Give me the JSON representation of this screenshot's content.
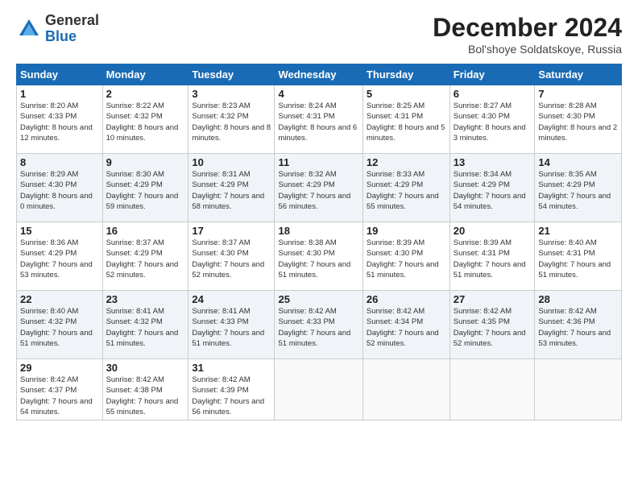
{
  "header": {
    "logo": {
      "general": "General",
      "blue": "Blue"
    },
    "title": "December 2024",
    "location": "Bol'shoye Soldatskoye, Russia"
  },
  "calendar": {
    "weekdays": [
      "Sunday",
      "Monday",
      "Tuesday",
      "Wednesday",
      "Thursday",
      "Friday",
      "Saturday"
    ],
    "weeks": [
      [
        {
          "day": 1,
          "sunrise": "8:20 AM",
          "sunset": "4:33 PM",
          "daylight": "8 hours and 12 minutes."
        },
        {
          "day": 2,
          "sunrise": "8:22 AM",
          "sunset": "4:32 PM",
          "daylight": "8 hours and 10 minutes."
        },
        {
          "day": 3,
          "sunrise": "8:23 AM",
          "sunset": "4:32 PM",
          "daylight": "8 hours and 8 minutes."
        },
        {
          "day": 4,
          "sunrise": "8:24 AM",
          "sunset": "4:31 PM",
          "daylight": "8 hours and 6 minutes."
        },
        {
          "day": 5,
          "sunrise": "8:25 AM",
          "sunset": "4:31 PM",
          "daylight": "8 hours and 5 minutes."
        },
        {
          "day": 6,
          "sunrise": "8:27 AM",
          "sunset": "4:30 PM",
          "daylight": "8 hours and 3 minutes."
        },
        {
          "day": 7,
          "sunrise": "8:28 AM",
          "sunset": "4:30 PM",
          "daylight": "8 hours and 2 minutes."
        }
      ],
      [
        {
          "day": 8,
          "sunrise": "8:29 AM",
          "sunset": "4:30 PM",
          "daylight": "8 hours and 0 minutes."
        },
        {
          "day": 9,
          "sunrise": "8:30 AM",
          "sunset": "4:29 PM",
          "daylight": "7 hours and 59 minutes."
        },
        {
          "day": 10,
          "sunrise": "8:31 AM",
          "sunset": "4:29 PM",
          "daylight": "7 hours and 58 minutes."
        },
        {
          "day": 11,
          "sunrise": "8:32 AM",
          "sunset": "4:29 PM",
          "daylight": "7 hours and 56 minutes."
        },
        {
          "day": 12,
          "sunrise": "8:33 AM",
          "sunset": "4:29 PM",
          "daylight": "7 hours and 55 minutes."
        },
        {
          "day": 13,
          "sunrise": "8:34 AM",
          "sunset": "4:29 PM",
          "daylight": "7 hours and 54 minutes."
        },
        {
          "day": 14,
          "sunrise": "8:35 AM",
          "sunset": "4:29 PM",
          "daylight": "7 hours and 54 minutes."
        }
      ],
      [
        {
          "day": 15,
          "sunrise": "8:36 AM",
          "sunset": "4:29 PM",
          "daylight": "7 hours and 53 minutes."
        },
        {
          "day": 16,
          "sunrise": "8:37 AM",
          "sunset": "4:29 PM",
          "daylight": "7 hours and 52 minutes."
        },
        {
          "day": 17,
          "sunrise": "8:37 AM",
          "sunset": "4:30 PM",
          "daylight": "7 hours and 52 minutes."
        },
        {
          "day": 18,
          "sunrise": "8:38 AM",
          "sunset": "4:30 PM",
          "daylight": "7 hours and 51 minutes."
        },
        {
          "day": 19,
          "sunrise": "8:39 AM",
          "sunset": "4:30 PM",
          "daylight": "7 hours and 51 minutes."
        },
        {
          "day": 20,
          "sunrise": "8:39 AM",
          "sunset": "4:31 PM",
          "daylight": "7 hours and 51 minutes."
        },
        {
          "day": 21,
          "sunrise": "8:40 AM",
          "sunset": "4:31 PM",
          "daylight": "7 hours and 51 minutes."
        }
      ],
      [
        {
          "day": 22,
          "sunrise": "8:40 AM",
          "sunset": "4:32 PM",
          "daylight": "7 hours and 51 minutes."
        },
        {
          "day": 23,
          "sunrise": "8:41 AM",
          "sunset": "4:32 PM",
          "daylight": "7 hours and 51 minutes."
        },
        {
          "day": 24,
          "sunrise": "8:41 AM",
          "sunset": "4:33 PM",
          "daylight": "7 hours and 51 minutes."
        },
        {
          "day": 25,
          "sunrise": "8:42 AM",
          "sunset": "4:33 PM",
          "daylight": "7 hours and 51 minutes."
        },
        {
          "day": 26,
          "sunrise": "8:42 AM",
          "sunset": "4:34 PM",
          "daylight": "7 hours and 52 minutes."
        },
        {
          "day": 27,
          "sunrise": "8:42 AM",
          "sunset": "4:35 PM",
          "daylight": "7 hours and 52 minutes."
        },
        {
          "day": 28,
          "sunrise": "8:42 AM",
          "sunset": "4:36 PM",
          "daylight": "7 hours and 53 minutes."
        }
      ],
      [
        {
          "day": 29,
          "sunrise": "8:42 AM",
          "sunset": "4:37 PM",
          "daylight": "7 hours and 54 minutes."
        },
        {
          "day": 30,
          "sunrise": "8:42 AM",
          "sunset": "4:38 PM",
          "daylight": "7 hours and 55 minutes."
        },
        {
          "day": 31,
          "sunrise": "8:42 AM",
          "sunset": "4:39 PM",
          "daylight": "7 hours and 56 minutes."
        },
        null,
        null,
        null,
        null
      ]
    ]
  }
}
